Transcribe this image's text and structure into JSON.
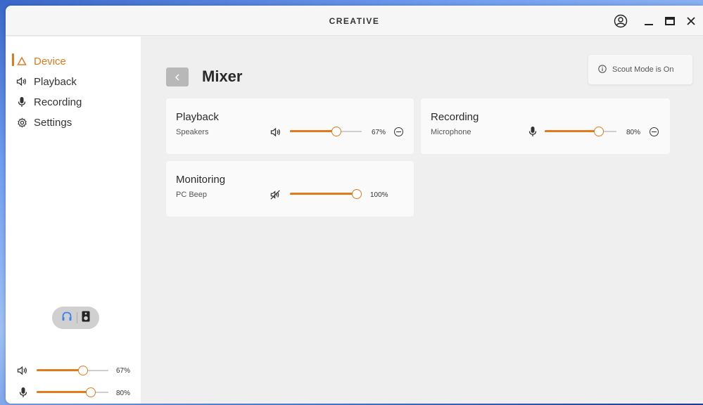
{
  "app": {
    "brand": "CREATIVE"
  },
  "sidebar": {
    "items": [
      {
        "label": "Device",
        "icon": "device-triangle-icon",
        "active": true
      },
      {
        "label": "Playback",
        "icon": "speaker-icon",
        "active": false
      },
      {
        "label": "Recording",
        "icon": "microphone-icon",
        "active": false
      },
      {
        "label": "Settings",
        "icon": "gear-icon",
        "active": false
      }
    ],
    "output_toggle": {
      "options": [
        "headphones-icon",
        "speaker-box-icon"
      ],
      "selected": "headphones-icon"
    },
    "quick_volume": {
      "value": 0.67,
      "label": "67%"
    },
    "quick_mic": {
      "value": 0.8,
      "label": "80%"
    }
  },
  "main": {
    "title": "Mixer",
    "scout_mode": "Scout Mode is On",
    "cards": [
      {
        "title": "Playback",
        "device": "Speakers",
        "level": 0.67,
        "label": "67%",
        "muted": false
      },
      {
        "title": "Recording",
        "device": "Microphone",
        "level": 0.8,
        "label": "80%",
        "muted": false
      },
      {
        "title": "Monitoring",
        "device": "PC Beep",
        "level": 1.0,
        "label": "100%",
        "muted": true
      }
    ]
  },
  "colors": {
    "accent": "#e07a1e",
    "background": "#efefef",
    "card": "#fafafa"
  }
}
